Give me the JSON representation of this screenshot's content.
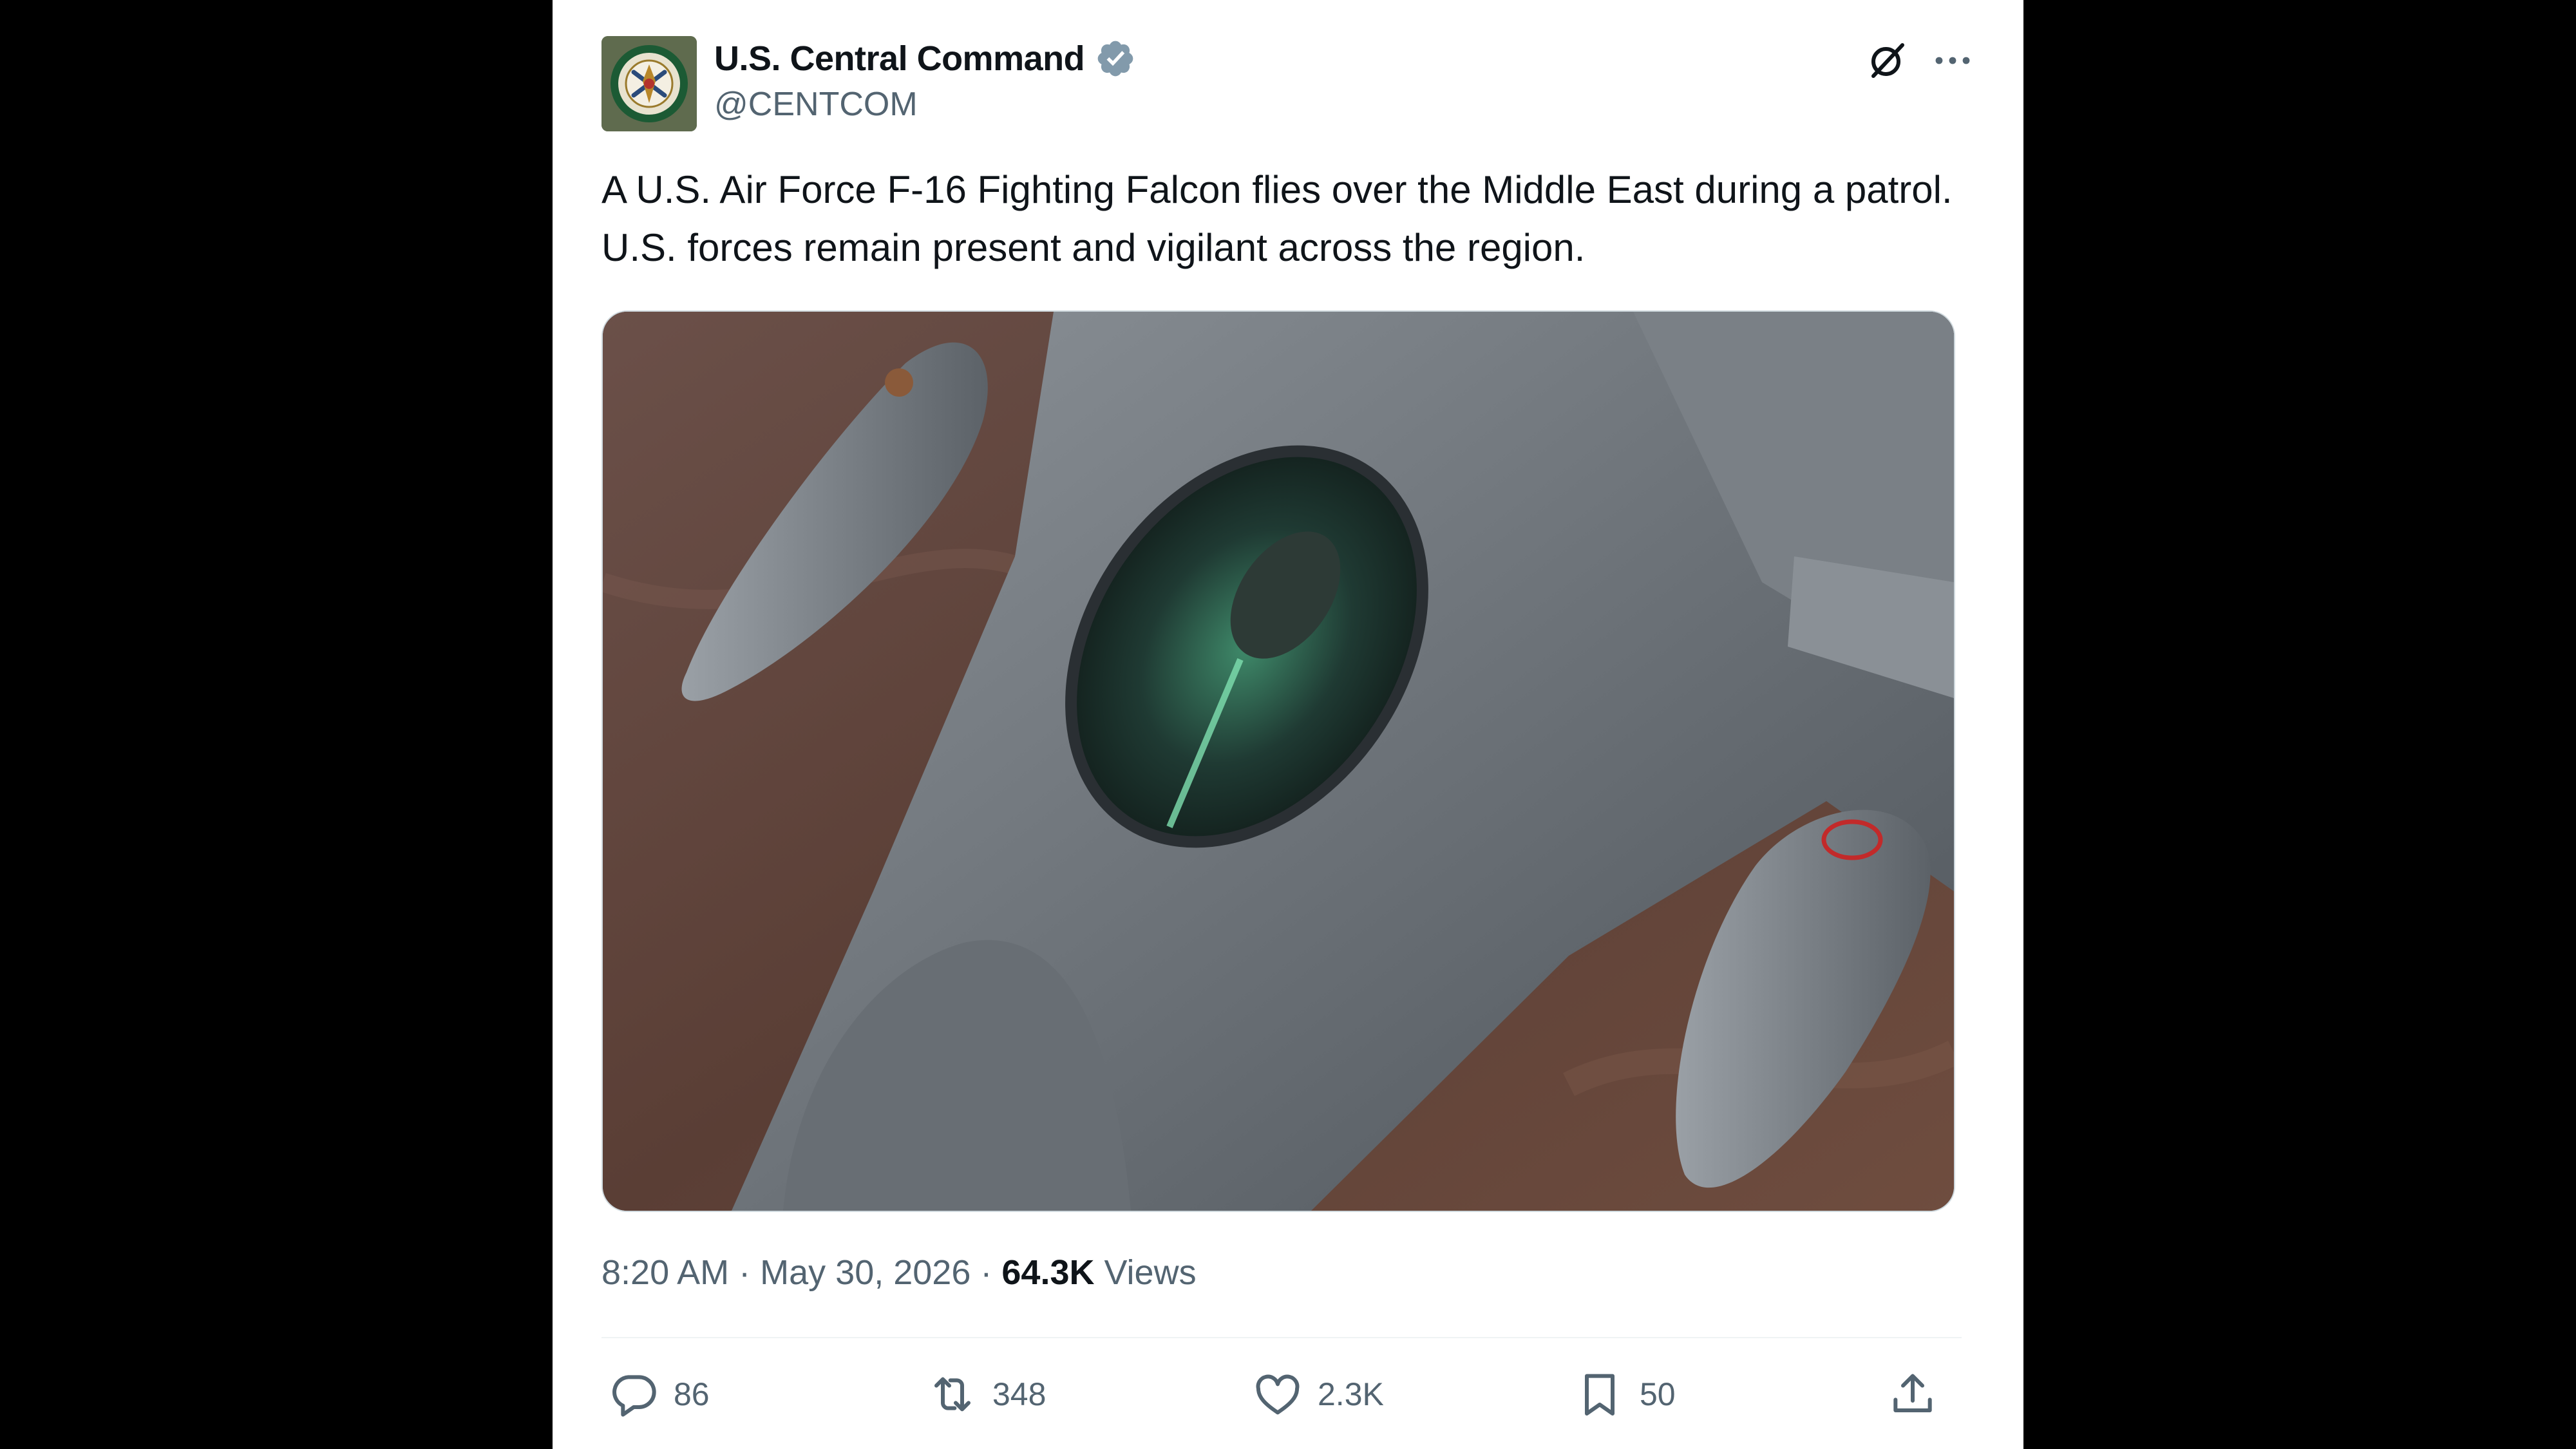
{
  "account": {
    "display_name": "U.S. Central Command",
    "handle": "@CENTCOM",
    "verified": true,
    "verified_badge_color": "#829aab"
  },
  "header_icons": {
    "grok": "grok-icon",
    "more": "more-icon"
  },
  "post": {
    "text": "A U.S. Air Force F-16 Fighting Falcon flies over the Middle East during a patrol. U.S. forces remain present and vigilant across the region.",
    "image_subject": "F-16 Fighting Falcon"
  },
  "meta": {
    "time": "8:20 AM",
    "separator": "·",
    "date": "May 30, 2026",
    "views_count": "64.3K",
    "views_label": "Views"
  },
  "actions": {
    "replies": "86",
    "reposts": "348",
    "likes": "2.3K",
    "bookmarks": "50",
    "icons": [
      "reply-icon",
      "repost-icon",
      "like-icon",
      "bookmark-icon",
      "share-icon"
    ]
  },
  "colors": {
    "text_primary": "#0f1419",
    "text_secondary": "#536471",
    "background": "#ffffff",
    "page_frame": "#000000"
  }
}
